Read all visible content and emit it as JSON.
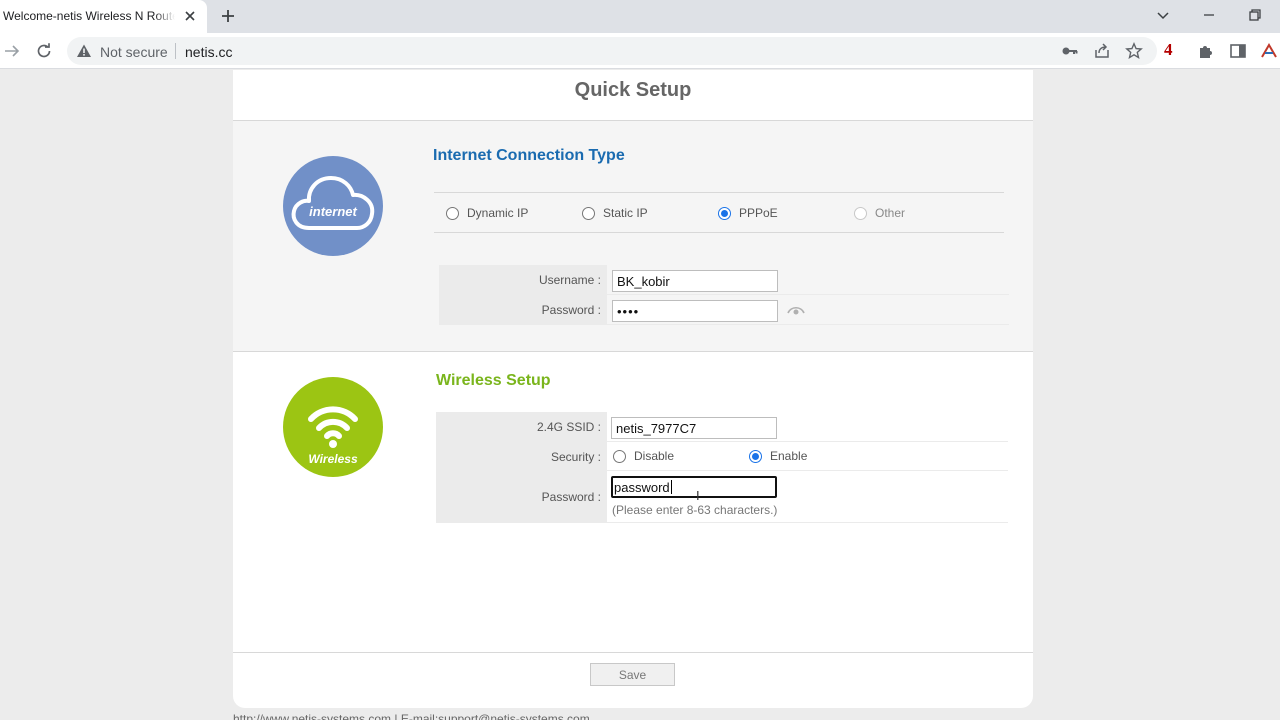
{
  "browser": {
    "tab_title": "Welcome-netis Wireless N Router",
    "security_label": "Not secure",
    "url": "netis.cc",
    "extension_badge": "4"
  },
  "page": {
    "title": "Quick Setup",
    "internet": {
      "icon_label": "internet",
      "section_title": "Internet Connection Type",
      "connection_types": [
        {
          "label": "Dynamic IP",
          "checked": false,
          "disabled": false
        },
        {
          "label": "Static IP",
          "checked": false,
          "disabled": false
        },
        {
          "label": "PPPoE",
          "checked": true,
          "disabled": false
        },
        {
          "label": "Other",
          "checked": false,
          "disabled": true
        }
      ],
      "username_label": "Username :",
      "username_value": "BK_kobir",
      "password_label": "Password :",
      "password_value": "••••"
    },
    "wireless": {
      "icon_label": "Wireless",
      "section_title": "Wireless Setup",
      "ssid_label": "2.4G SSID :",
      "ssid_value": "netis_7977C7",
      "security_label": "Security :",
      "security_options": [
        {
          "label": "Disable",
          "checked": false
        },
        {
          "label": "Enable",
          "checked": true
        }
      ],
      "password_label": "Password :",
      "password_value": "password",
      "password_hint": "(Please enter 8-63 characters.)"
    },
    "save_label": "Save",
    "footer": "http://www.netis-systems.com | E-mail:support@netis-systems.com"
  },
  "colors": {
    "internet_title": "#1a6bb0",
    "wireless_title": "#7ab51c",
    "internet_circle": "#7190c8",
    "wireless_circle": "#9cc513",
    "radio_checked": "#1a73e8"
  }
}
